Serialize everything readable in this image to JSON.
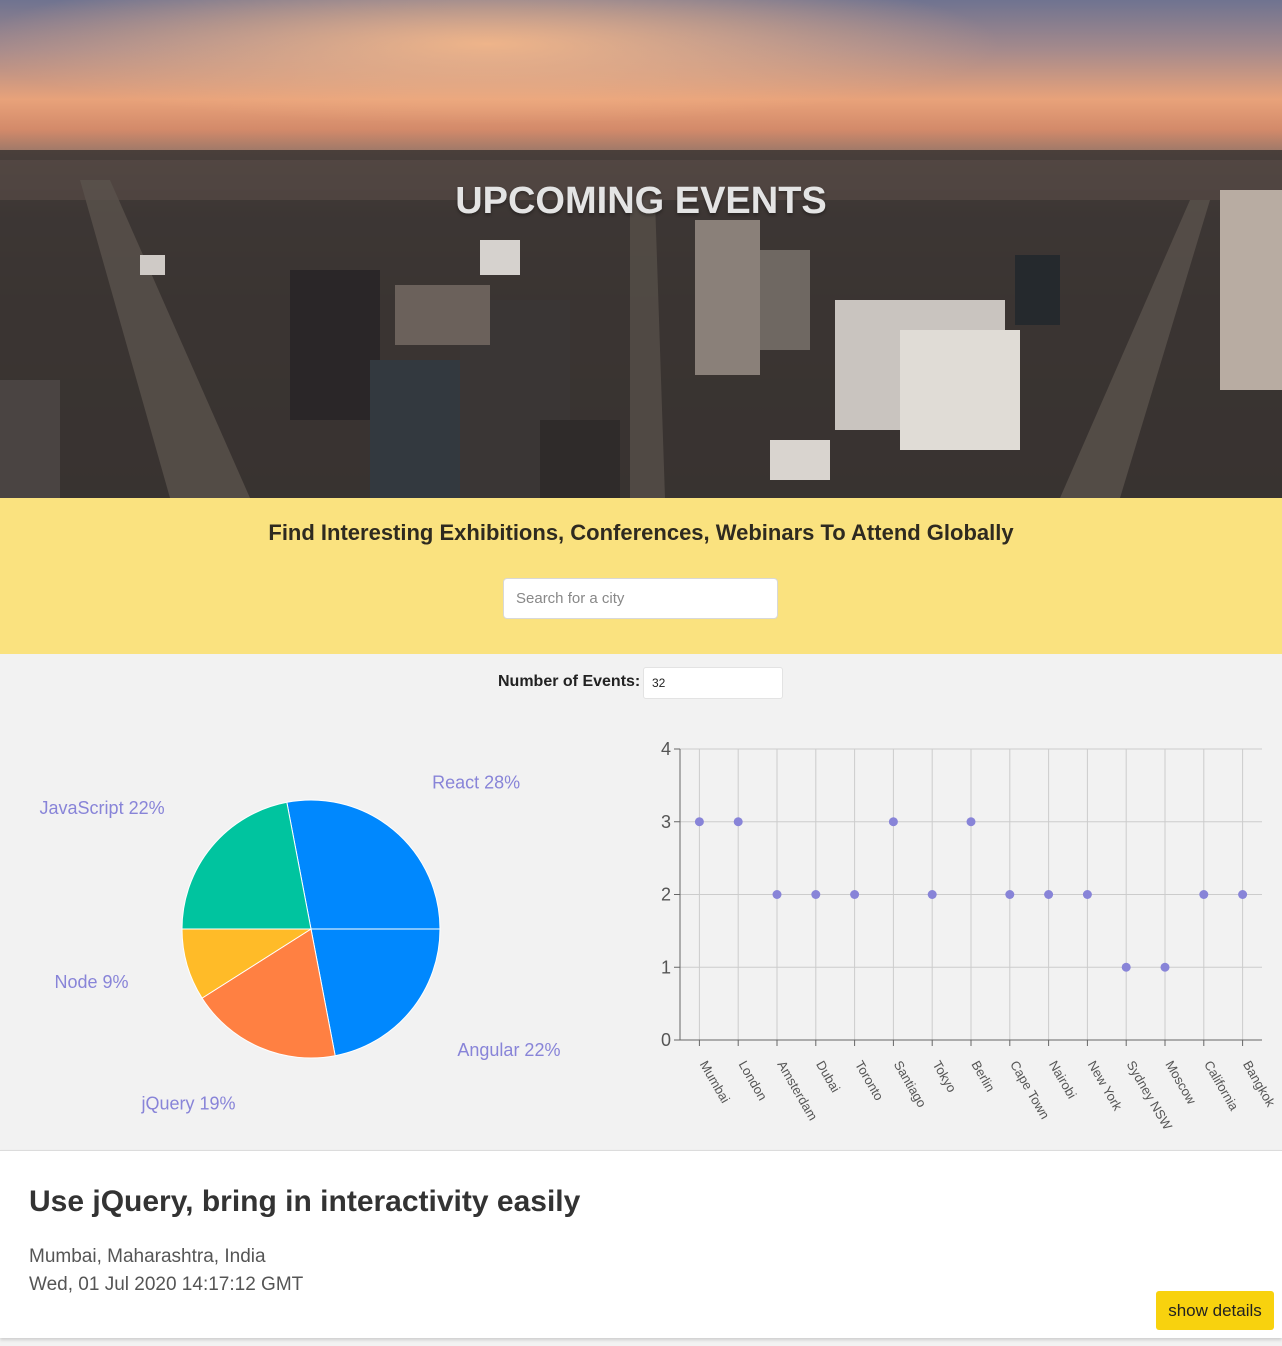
{
  "hero": {
    "title": "UPCOMING EVENTS",
    "image_description": "aerial city panorama at sunset"
  },
  "banner": {
    "tagline": "Find Interesting Exhibitions, Conferences, Webinars To Attend Globally",
    "search_placeholder": "Search for a city"
  },
  "events_count": {
    "label": "Number of Events:",
    "value": "32"
  },
  "chart_data": [
    {
      "type": "pie",
      "slices": [
        {
          "label": "React",
          "value": 28,
          "display": "React 28%",
          "color": "#0088fe"
        },
        {
          "label": "Angular",
          "value": 22,
          "display": "Angular 22%",
          "color": "#0088fe"
        },
        {
          "label": "jQuery",
          "value": 19,
          "display": "jQuery 19%",
          "color": "#ff8042"
        },
        {
          "label": "Node",
          "value": 9,
          "display": "Node 9%",
          "color": "#ffbb28"
        },
        {
          "label": "JavaScript",
          "value": 22,
          "display": "JavaScript 22%",
          "color": "#00c49f"
        }
      ],
      "label_color": "#8884d8"
    },
    {
      "type": "scatter",
      "categories": [
        "Mumbai",
        "London",
        "Amsterdam",
        "Dubai",
        "Toronto",
        "Santiago",
        "Tokyo",
        "Berlin",
        "Cape Town",
        "Nairobi",
        "New York",
        "Sydney NSW",
        "Moscow",
        "California",
        "Bangkok"
      ],
      "values": [
        3,
        3,
        2,
        2,
        2,
        3,
        2,
        3,
        2,
        2,
        2,
        1,
        1,
        2,
        2
      ],
      "ylim": [
        0,
        4
      ],
      "yticks": [
        0,
        1,
        2,
        3,
        4
      ],
      "grid": true,
      "point_color": "#8884d8"
    }
  ],
  "event_card": {
    "title": "Use jQuery, bring in interactivity easily",
    "location": "Mumbai, Maharashtra, India",
    "date": "Wed, 01 Jul 2020 14:17:12 GMT",
    "button_label": "show details"
  }
}
